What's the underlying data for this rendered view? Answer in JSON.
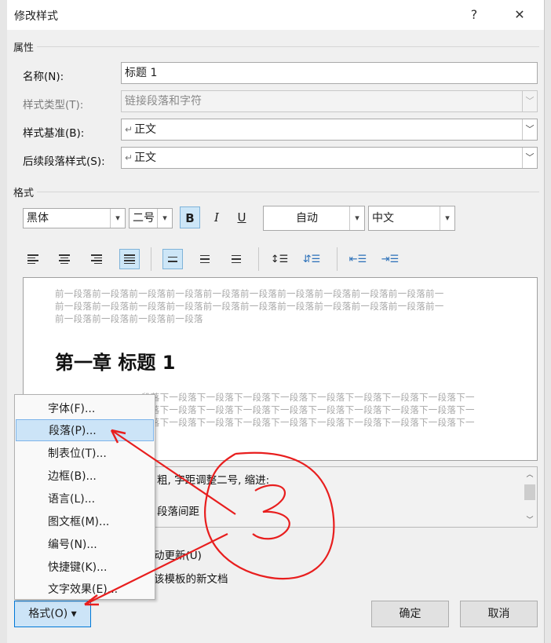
{
  "dialog": {
    "title": "修改样式",
    "help": "?",
    "close": "✕"
  },
  "properties": {
    "section": "属性",
    "name_label": "名称(N):",
    "name_value": "标题 1",
    "type_label": "样式类型(T):",
    "type_value": "链接段落和字符",
    "based_label": "样式基准(B):",
    "based_value": "正文",
    "next_label": "后续段落样式(S):",
    "next_value": "正文"
  },
  "format": {
    "section": "格式",
    "font": "黑体",
    "size": "二号",
    "bold": "B",
    "italic": "I",
    "underline": "U",
    "color": "自动",
    "script": "中文"
  },
  "preview": {
    "prev_lines": [
      "前一段落前一段落前一段落前一段落前一段落前一段落前一段落前一段落前一段落前一段落前一",
      "前一段落前一段落前一段落前一段落前一段落前一段落前一段落前一段落前一段落前一段落前一",
      "前一段落前一段落前一段落前一段落"
    ],
    "heading": "第一章   标题 1",
    "next_lines": [
      "段落下一段落下一段落下一段落下一段落下一段落下一段落下一段落下一段落下一",
      "段落下一段落下一段落下一段落下一段落下一段落下一段落下一段落下一段落下一",
      "段落下一段落下一段落下一段落下一段落下一段落下一段落下一段落下一段落下一"
    ]
  },
  "description": {
    "line1": "粗, 字距调整二号, 缩进:",
    "line2": "段落间距"
  },
  "options": {
    "auto_update": "动更新(U)",
    "new_docs": "该模板的新文档"
  },
  "buttons": {
    "format": "格式(O) ▾",
    "ok": "确定",
    "cancel": "取消"
  },
  "menu": {
    "items": [
      "字体(F)...",
      "段落(P)...",
      "制表位(T)...",
      "边框(B)...",
      "语言(L)...",
      "图文框(M)...",
      "编号(N)...",
      "快捷键(K)...",
      "文字效果(E)..."
    ],
    "highlighted": 1
  },
  "annotation": {
    "label": "3",
    "color": "#e81e1e"
  }
}
